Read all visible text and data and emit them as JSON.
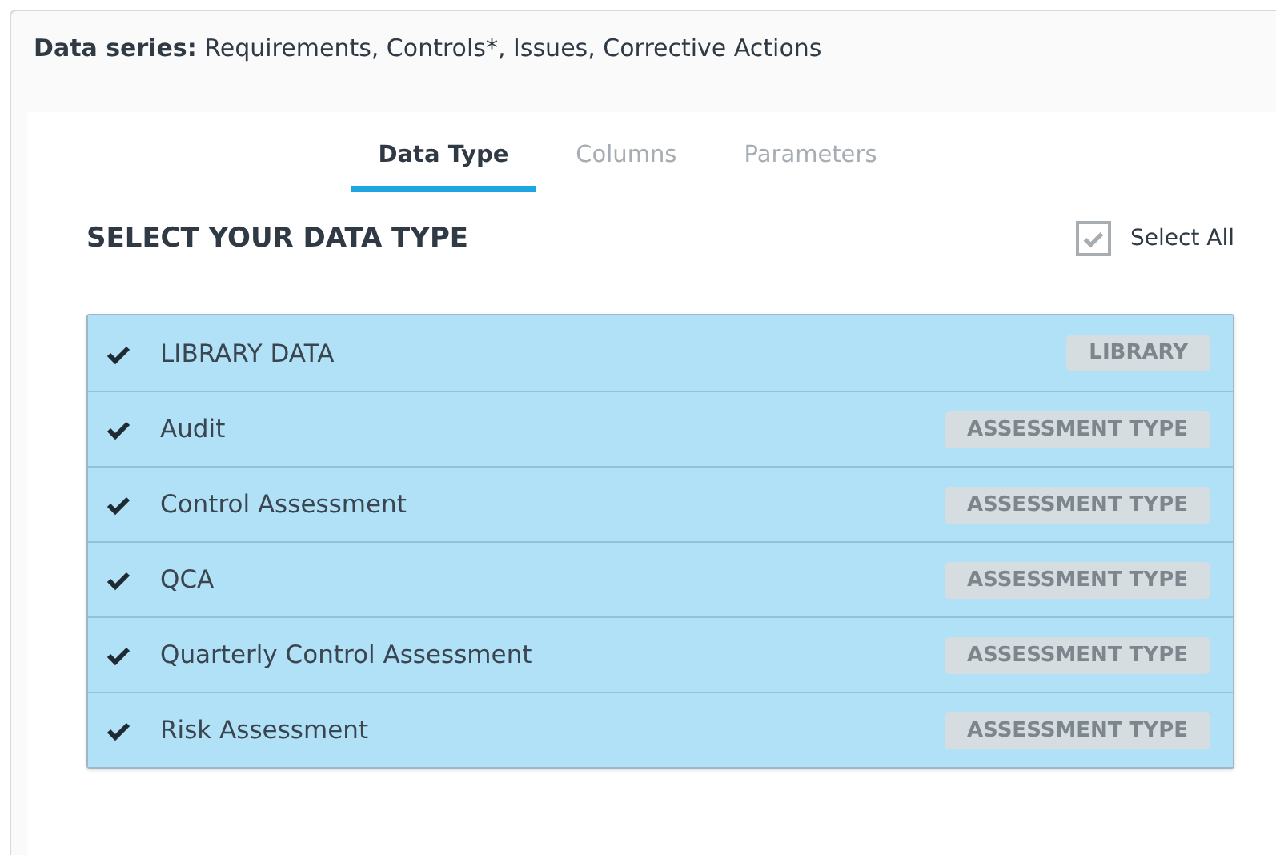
{
  "data_series": {
    "label": "Data series:",
    "value": "Requirements, Controls*, Issues, Corrective Actions"
  },
  "tabs": [
    {
      "label": "Data Type",
      "selected": true
    },
    {
      "label": "Columns",
      "selected": false
    },
    {
      "label": "Parameters",
      "selected": false
    }
  ],
  "section": {
    "title": "SELECT YOUR DATA TYPE",
    "select_all": {
      "label": "Select All",
      "checked": true
    }
  },
  "data_types": [
    {
      "name": "LIBRARY DATA",
      "tag": "LIBRARY",
      "selected": true
    },
    {
      "name": "Audit",
      "tag": "ASSESSMENT TYPE",
      "selected": true
    },
    {
      "name": "Control Assessment",
      "tag": "ASSESSMENT TYPE",
      "selected": true
    },
    {
      "name": "QCA",
      "tag": "ASSESSMENT TYPE",
      "selected": true
    },
    {
      "name": "Quarterly Control Assessment",
      "tag": "ASSESSMENT TYPE",
      "selected": true
    },
    {
      "name": "Risk Assessment",
      "tag": "ASSESSMENT TYPE",
      "selected": true
    }
  ]
}
